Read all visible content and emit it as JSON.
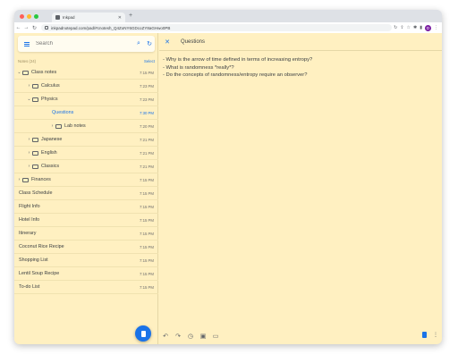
{
  "browser": {
    "tab_title": "Inkpad",
    "tab_close": "✕",
    "new_tab": "+",
    "url": "inkpadnotepad.com/pad/#cnotesh_Q4ZoNY6GDcoZY8aGHwo0PB",
    "nav": {
      "back": "←",
      "forward": "→",
      "reload": "↻"
    },
    "extras": [
      "↻",
      "⇪",
      "☆",
      "✱",
      "▮",
      "⋮"
    ],
    "profile_initial": "D"
  },
  "sidebar": {
    "search_placeholder": "Search",
    "notes_label": "Notes (24)",
    "select_label": "Select",
    "rows": [
      {
        "label": "Class notes",
        "time": "7:15 PM"
      },
      {
        "label": "Calculus",
        "time": "7:23 PM"
      },
      {
        "label": "Physics",
        "time": "7:23 PM"
      },
      {
        "label": "Questions",
        "time": "7:30 PM"
      },
      {
        "label": "Lab notes",
        "time": "7:20 PM"
      },
      {
        "label": "Japanese",
        "time": "7:21 PM"
      },
      {
        "label": "English",
        "time": "7:21 PM"
      },
      {
        "label": "Classics",
        "time": "7:21 PM"
      },
      {
        "label": "Finances",
        "time": "7:15 PM"
      },
      {
        "label": "Class Schedule",
        "time": "7:15 PM"
      },
      {
        "label": "Flight Info",
        "time": "7:15 PM"
      },
      {
        "label": "Hotel Info",
        "time": "7:15 PM"
      },
      {
        "label": "Itinerary",
        "time": "7:15 PM"
      },
      {
        "label": "Coconut Rice Recipe",
        "time": "7:15 PM"
      },
      {
        "label": "Shopping List",
        "time": "7:15 PM"
      },
      {
        "label": "Lentil Soup Recipe",
        "time": "7:15 PM"
      },
      {
        "label": "To-do List",
        "time": "7:15 PM"
      }
    ]
  },
  "editor": {
    "close_icon": "✕",
    "title": "Questions",
    "lines": [
      "- Why is the arrow of time defined in terms of increasing entropy?",
      "- What is randomness *really*?",
      "- Do the concepts of randomness/entropy require an observer?"
    ],
    "tools": {
      "undo": "↶",
      "redo": "↷",
      "history": "◷",
      "image": "▣",
      "label": "▭"
    },
    "more": "⋮"
  },
  "colors": {
    "accent": "#1a73e8",
    "background": "#fff0c1"
  }
}
